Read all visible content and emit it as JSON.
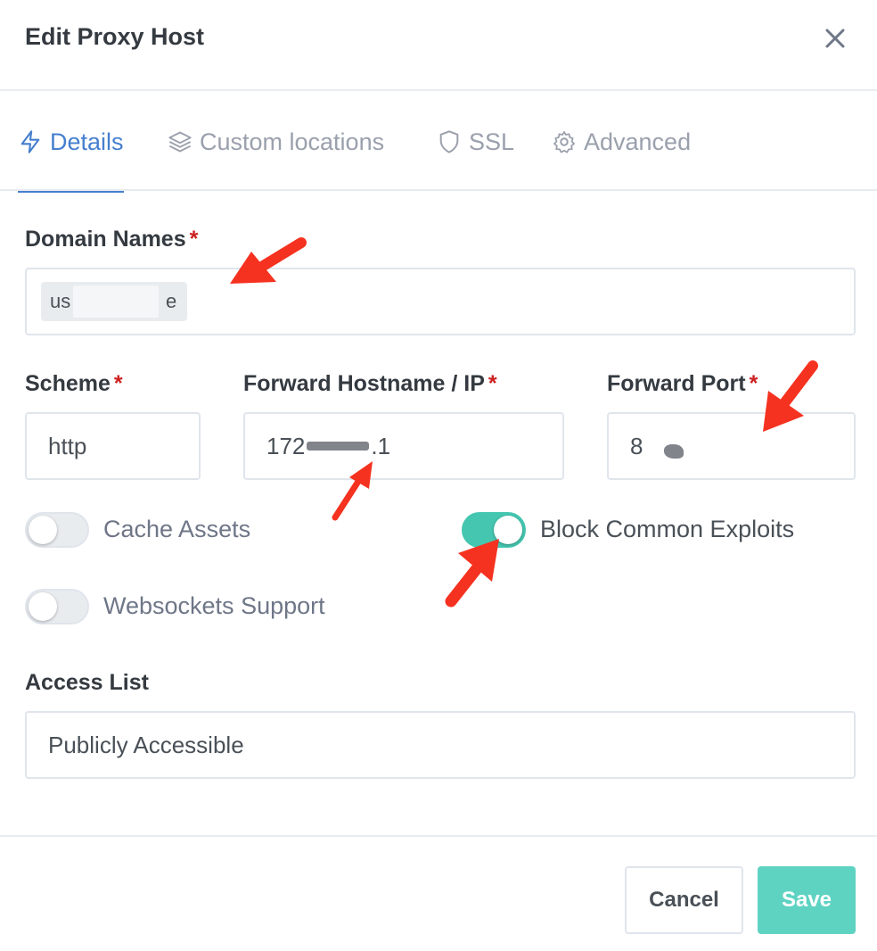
{
  "dialog": {
    "title": "Edit Proxy Host"
  },
  "tabs": [
    {
      "label": "Details",
      "icon": "lightning-icon",
      "active": true
    },
    {
      "label": "Custom locations",
      "icon": "layers-icon",
      "active": false
    },
    {
      "label": "SSL",
      "icon": "shield-icon",
      "active": false
    },
    {
      "label": "Advanced",
      "icon": "gear-icon",
      "active": false
    }
  ],
  "form": {
    "required_mark": "*",
    "domain_names": {
      "label": "Domain Names",
      "tag_start": "us",
      "tag_end": "e"
    },
    "scheme": {
      "label": "Scheme",
      "value": "http"
    },
    "forward_host": {
      "label": "Forward Hostname / IP",
      "value_start": "172",
      "value_end": ".1"
    },
    "forward_port": {
      "label": "Forward Port",
      "value_start": "8"
    },
    "toggles": {
      "cache_assets": {
        "label": "Cache Assets",
        "on": false
      },
      "block_exploits": {
        "label": "Block Common Exploits",
        "on": true
      },
      "websockets": {
        "label": "Websockets Support",
        "on": false
      }
    },
    "access_list": {
      "label": "Access List",
      "value": "Publicly Accessible"
    }
  },
  "footer": {
    "cancel_label": "Cancel",
    "save_label": "Save"
  },
  "colors": {
    "accent": "#467fcf",
    "toggle_on": "#45c6b0",
    "save": "#5fd3c2",
    "required": "#cd201f",
    "annotation_arrow": "#f5321f"
  }
}
